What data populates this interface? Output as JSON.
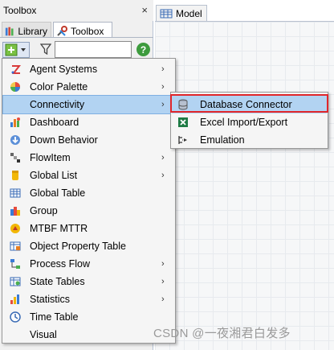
{
  "panel": {
    "title": "Toolbox",
    "close": "×",
    "tabs": [
      {
        "label": "Library",
        "icon": "library-books-icon"
      },
      {
        "label": "Toolbox",
        "icon": "tools-icon"
      }
    ],
    "filter_value": "",
    "help": "?"
  },
  "model_tab": {
    "label": "Model",
    "icon": "grid-icon"
  },
  "menu": {
    "items": [
      {
        "label": "Agent Systems",
        "icon": "agent-systems-icon",
        "submenu": true
      },
      {
        "label": "Color Palette",
        "icon": "color-palette-icon",
        "submenu": true
      },
      {
        "label": "Connectivity",
        "icon": "connectivity-icon",
        "submenu": true,
        "active": true
      },
      {
        "label": "Dashboard",
        "icon": "dashboard-icon",
        "submenu": false
      },
      {
        "label": "Down Behavior",
        "icon": "down-behavior-icon",
        "submenu": false
      },
      {
        "label": "FlowItem",
        "icon": "flowitem-icon",
        "submenu": true
      },
      {
        "label": "Global List",
        "icon": "global-list-icon",
        "submenu": true
      },
      {
        "label": "Global Table",
        "icon": "global-table-icon",
        "submenu": false
      },
      {
        "label": "Group",
        "icon": "group-icon",
        "submenu": false
      },
      {
        "label": "MTBF MTTR",
        "icon": "mtbf-mttr-icon",
        "submenu": false
      },
      {
        "label": "Object Property Table",
        "icon": "object-property-table-icon",
        "submenu": false
      },
      {
        "label": "Process Flow",
        "icon": "process-flow-icon",
        "submenu": true
      },
      {
        "label": "State Tables",
        "icon": "state-tables-icon",
        "submenu": true
      },
      {
        "label": "Statistics",
        "icon": "statistics-icon",
        "submenu": true
      },
      {
        "label": "Time Table",
        "icon": "time-table-icon",
        "submenu": false
      },
      {
        "label": "Visual",
        "icon": "",
        "submenu": false
      }
    ],
    "arrow": "›"
  },
  "submenu": {
    "items": [
      {
        "label": "Database Connector",
        "icon": "database-icon",
        "active": true
      },
      {
        "label": "Excel Import/Export",
        "icon": "excel-icon"
      },
      {
        "label": "Emulation",
        "icon": "emulation-icon"
      }
    ]
  },
  "watermark": "CSDN @一夜湘君白发多",
  "colors": {
    "highlight": "#b2d3f2",
    "callout_border": "#e0262b"
  }
}
